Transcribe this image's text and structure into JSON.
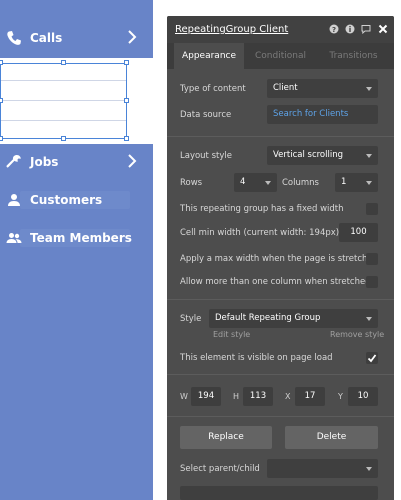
{
  "nav": {
    "items": [
      {
        "label": "Calls",
        "icon": "phone-icon",
        "has_chevron": true
      },
      {
        "label": "Jobs",
        "icon": "wrench-icon",
        "has_chevron": true
      },
      {
        "label": "Customers",
        "icon": "person-icon",
        "has_chevron": false
      },
      {
        "label": "Team Members",
        "icon": "people-icon",
        "has_chevron": false
      }
    ],
    "colors": {
      "background": "#6884c8",
      "selection": "#4a84d8"
    }
  },
  "panel": {
    "title": "RepeatingGroup Client",
    "header_icons": [
      "help-icon",
      "info-icon",
      "comment-icon",
      "close-icon"
    ],
    "tabs": [
      {
        "label": "Appearance",
        "active": true
      },
      {
        "label": "Conditional",
        "active": false
      },
      {
        "label": "Transitions",
        "active": false
      }
    ],
    "type_of_content": {
      "label": "Type of content",
      "value": "Client"
    },
    "data_source": {
      "label": "Data source",
      "value": "Search for Clients"
    },
    "layout_style": {
      "label": "Layout style",
      "value": "Vertical scrolling"
    },
    "rows": {
      "label": "Rows",
      "value": "4"
    },
    "columns": {
      "label": "Columns",
      "value": "1"
    },
    "fixed_width": {
      "label": "This repeating group has a fixed width",
      "checked": false
    },
    "cell_min_width": {
      "label": "Cell min width (current width: 194px)",
      "value": "100"
    },
    "max_width": {
      "label": "Apply a max width when the page is stretched",
      "checked": false
    },
    "more_columns": {
      "label": "Allow more than one column when stretched",
      "checked": false
    },
    "style": {
      "label": "Style",
      "value": "Default Repeating Group",
      "edit": "Edit style",
      "remove": "Remove style"
    },
    "visible_on_load": {
      "label": "This element is visible on page load",
      "checked": true
    },
    "geometry": [
      {
        "label": "W",
        "value": "194"
      },
      {
        "label": "H",
        "value": "113"
      },
      {
        "label": "X",
        "value": "17"
      },
      {
        "label": "Y",
        "value": "10"
      }
    ],
    "replace_label": "Replace",
    "delete_label": "Delete",
    "parent_child_label": "Select parent/child",
    "colors": {
      "background": "#4d4d4d",
      "header": "#414141",
      "link": "#5ea3e8"
    }
  }
}
